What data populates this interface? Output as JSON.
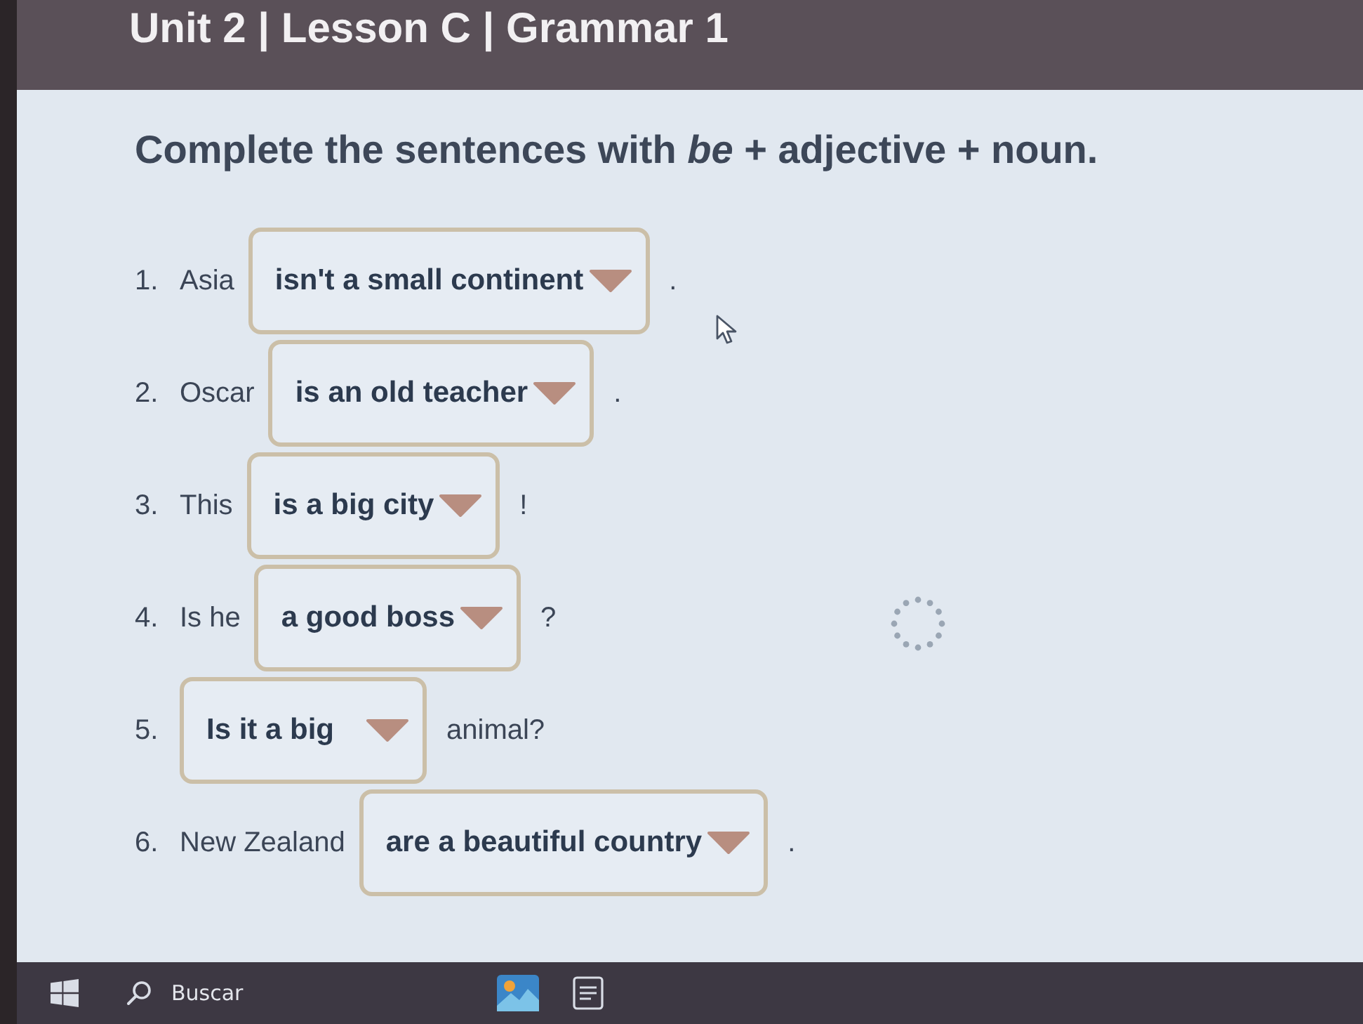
{
  "header": {
    "title": "Unit 2 | Lesson C | Grammar 1"
  },
  "instruction": "Complete the sentences with *be* + adjective + noun.",
  "items": [
    {
      "number": "1.",
      "before": "Asia",
      "answer": "isn't a small continent",
      "after": "."
    },
    {
      "number": "2.",
      "before": "Oscar",
      "answer": "is an old teacher",
      "after": "."
    },
    {
      "number": "3.",
      "before": "This",
      "answer": "is a big city",
      "after": "!"
    },
    {
      "number": "4.",
      "before": "Is he",
      "answer": "a good boss",
      "after": "?"
    },
    {
      "number": "5.",
      "answer": "Is it a big",
      "after": "animal?"
    },
    {
      "number": "6.",
      "before": "New Zealand",
      "answer": "are a beautiful country",
      "after": "."
    }
  ],
  "mouse_pointer": true,
  "loading": true,
  "taskbar": {
    "search": {
      "placeholder": "Buscar"
    }
  }
}
